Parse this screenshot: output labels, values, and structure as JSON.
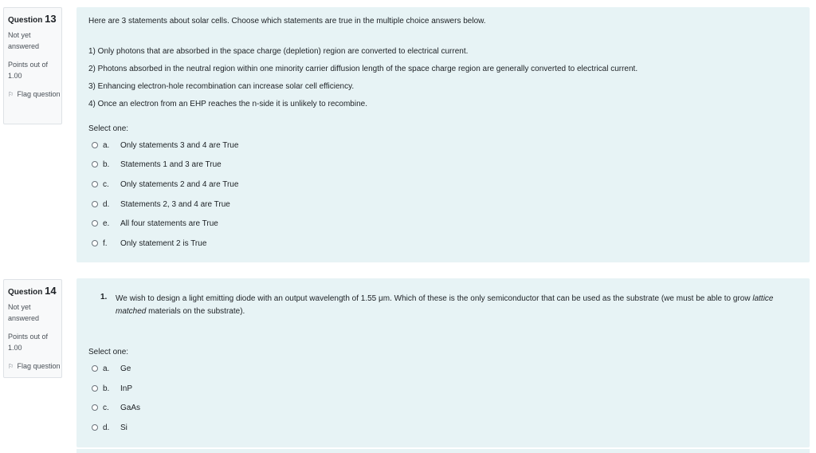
{
  "q13": {
    "label": "Question",
    "number": "13",
    "state": "Not yet answered",
    "grade": "Points out of 1.00",
    "flag": "Flag question",
    "intro": "Here are 3 statements about solar cells. Choose which statements are true in the multiple choice answers below.",
    "statements": [
      "1) Only photons that are absorbed in the space charge (depletion) region are converted to electrical current.",
      "2) Photons absorbed in the neutral region within one minority carrier diffusion length of the space charge region are generally converted to electrical current.",
      "3) Enhancing electron-hole recombination can increase solar cell efficiency.",
      "4) Once an electron from an EHP reaches the n-side it is unlikely to recombine."
    ],
    "select_one": "Select one:",
    "options": [
      {
        "letter": "a.",
        "text": "Only statements 3 and 4 are True"
      },
      {
        "letter": "b.",
        "text": "Statements 1 and 3 are True"
      },
      {
        "letter": "c.",
        "text": "Only statements 2 and 4 are True"
      },
      {
        "letter": "d.",
        "text": "Statements 2, 3 and 4 are True"
      },
      {
        "letter": "e.",
        "text": "All four statements are True"
      },
      {
        "letter": "f.",
        "text": "Only statement 2 is True"
      }
    ]
  },
  "q14": {
    "label": "Question",
    "number": "14",
    "state": "Not yet answered",
    "grade": "Points out of 1.00",
    "flag": "Flag question",
    "item_number": "1.",
    "text_before": "We wish to design a light emitting diode with an output wavelength of 1.55 μm.  Which of these is the only semiconductor that can be used as the substrate (we must be able to grow ",
    "text_italic": "lattice matched",
    "text_after": " materials on the substrate).",
    "select_one": "Select one:",
    "options": [
      {
        "letter": "a.",
        "text": "Ge"
      },
      {
        "letter": "b.",
        "text": "InP"
      },
      {
        "letter": "c.",
        "text": "GaAs"
      },
      {
        "letter": "d.",
        "text": "Si"
      }
    ]
  }
}
